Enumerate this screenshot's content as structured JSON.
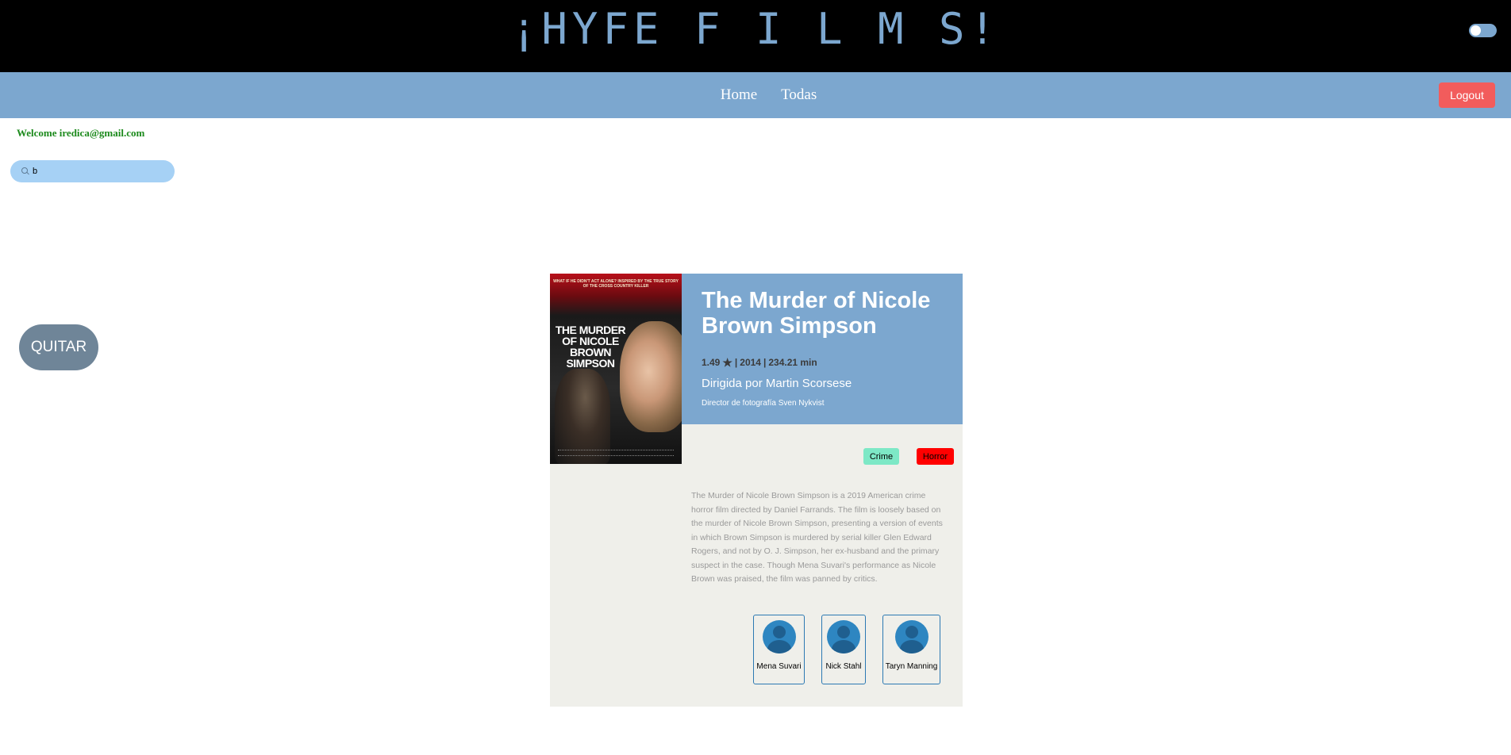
{
  "app": {
    "logo": "¡HYFE F I L M S!"
  },
  "nav": {
    "items": [
      "Home",
      "Todas"
    ],
    "logout_label": "Logout"
  },
  "user": {
    "welcome": "Welcome iredica@gmail.com"
  },
  "search": {
    "value": "b"
  },
  "actions": {
    "quitar_label": "QUITAR"
  },
  "film": {
    "poster_tagline": "WHAT IF HE DIDN'T ACT ALONE? INSPIRED BY THE TRUE STORY OF THE CROSS COUNTRY KILLER",
    "poster_title": "THE MURDER OF NICOLE BROWN SIMPSON",
    "title": "The Murder of Nicole Brown Simpson",
    "rating": "1.49",
    "year": "2014",
    "duration": "234.21 min",
    "director": "Dirigida por Martin Scorsese",
    "cinematographer": "Director de fotografía Sven Nykvist",
    "genres": [
      "Crime",
      "Horror"
    ],
    "synopsis": "The Murder of Nicole Brown Simpson is a 2019 American crime horror film directed by Daniel Farrands. The film is loosely based on the murder of Nicole Brown Simpson, presenting a version of events in which Brown Simpson is murdered by serial killer Glen Edward Rogers, and not by O. J. Simpson, her ex-husband and the primary suspect in the case. Though Mena Suvari's performance as Nicole Brown was praised, the film was panned by critics.",
    "cast": [
      "Mena Suvari",
      "Nick Stahl",
      "Taryn Manning"
    ]
  },
  "colors": {
    "accent": "#7ca7cf",
    "logout": "#f25c5c",
    "welcome": "#1c8a1c",
    "genre_crime": "#7de8c6",
    "genre_horror": "#ff0000"
  },
  "icons": {
    "search": "search-icon",
    "rating": "star-icon",
    "actor": "user-avatar-icon"
  }
}
